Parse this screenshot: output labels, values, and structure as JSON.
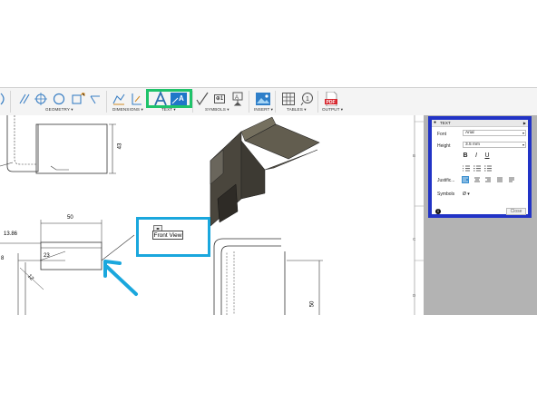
{
  "toolbar": {
    "groups": [
      {
        "label": "GEOMETRY ▾"
      },
      {
        "label": "DIMENSIONS ▾"
      },
      {
        "label": "TEXT ▾"
      },
      {
        "label": "SYMBOLS ▾"
      },
      {
        "label": "INSERT ▾"
      },
      {
        "label": "TABLES ▾"
      },
      {
        "label": "OUTPUT ▾"
      }
    ],
    "symbols_button_label": "⊕1",
    "output_pdf_label": "PDF",
    "tables_balloon_label": "1",
    "dropdown_arrow": "▾"
  },
  "drawing": {
    "dims": {
      "d50_top": "50",
      "d1386": "13.86",
      "d23": "23",
      "d8": "8",
      "d43": "43",
      "d50_right": "50",
      "d12": "12"
    },
    "front_view_label": "Front View",
    "note_handle": "◂▸",
    "zones": {
      "b": "B",
      "c": "C",
      "d": "D"
    }
  },
  "text_panel": {
    "title": "TEXT",
    "font_label": "Font",
    "font_value": "Arial",
    "height_label": "Height",
    "height_value": "3.5 mm",
    "bold": "B",
    "italic": "I",
    "underline": "U",
    "justification_label": "Justific...",
    "symbols_label": "Symbols",
    "symbols_value": "Ø ▾",
    "close_label": "Close",
    "info_icon_text": "i"
  },
  "colors": {
    "accent_green": "#1fc36a",
    "accent_cyan": "#1aa7dd",
    "panel_border_blue": "#2133c6",
    "justify_active": "#3a8fd0"
  }
}
